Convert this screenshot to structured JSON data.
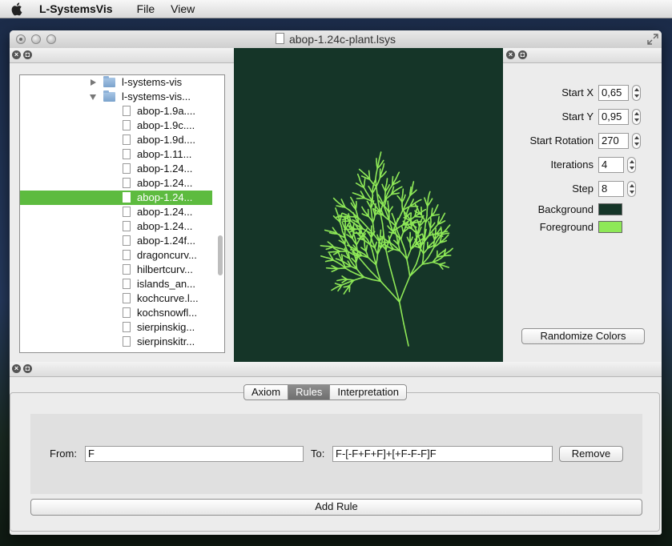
{
  "menubar": {
    "app_name": "L-SystemsVis",
    "menus": [
      "File",
      "View"
    ]
  },
  "window": {
    "title": "abop-1.24c-plant.lsys"
  },
  "tree": {
    "items": [
      {
        "label": "l-systems-vis",
        "kind": "folder",
        "expanded": false
      },
      {
        "label": "l-systems-vis...",
        "kind": "folder",
        "expanded": true
      },
      {
        "label": "abop-1.9a....",
        "kind": "file"
      },
      {
        "label": "abop-1.9c....",
        "kind": "file"
      },
      {
        "label": "abop-1.9d....",
        "kind": "file"
      },
      {
        "label": "abop-1.11...",
        "kind": "file"
      },
      {
        "label": "abop-1.24...",
        "kind": "file"
      },
      {
        "label": "abop-1.24...",
        "kind": "file"
      },
      {
        "label": "abop-1.24...",
        "kind": "file",
        "selected": true
      },
      {
        "label": "abop-1.24...",
        "kind": "file"
      },
      {
        "label": "abop-1.24...",
        "kind": "file"
      },
      {
        "label": "abop-1.24f...",
        "kind": "file"
      },
      {
        "label": "dragoncurv...",
        "kind": "file"
      },
      {
        "label": "hilbertcurv...",
        "kind": "file"
      },
      {
        "label": "islands_an...",
        "kind": "file"
      },
      {
        "label": "kochcurve.l...",
        "kind": "file"
      },
      {
        "label": "kochsnowfl...",
        "kind": "file"
      },
      {
        "label": "sierpinskig...",
        "kind": "file"
      },
      {
        "label": "sierpinskitr...",
        "kind": "file"
      }
    ]
  },
  "canvas": {
    "background": "#153528",
    "foreground": "#8ee857"
  },
  "props": {
    "start_x_label": "Start X",
    "start_x": "0,65",
    "start_y_label": "Start Y",
    "start_y": "0,95",
    "start_rotation_label": "Start Rotation",
    "start_rotation": "270",
    "iterations_label": "Iterations",
    "iterations": "4",
    "step_label": "Step",
    "step": "8",
    "background_label": "Background",
    "background_color": "#153528",
    "foreground_label": "Foreground",
    "foreground_color": "#8ee857",
    "randomize_label": "Randomize Colors"
  },
  "tabs": {
    "axiom": "Axiom",
    "rules": "Rules",
    "interpretation": "Interpretation",
    "active": "Rules"
  },
  "rule": {
    "from_label": "From:",
    "from_value": "F",
    "to_label": "To:",
    "to_value": "F-[-F+F+F]+[+F-F-F]F",
    "remove_label": "Remove"
  },
  "add_rule_label": "Add Rule",
  "pane_icons": {
    "close": "close-icon",
    "detach": "detach-icon"
  }
}
